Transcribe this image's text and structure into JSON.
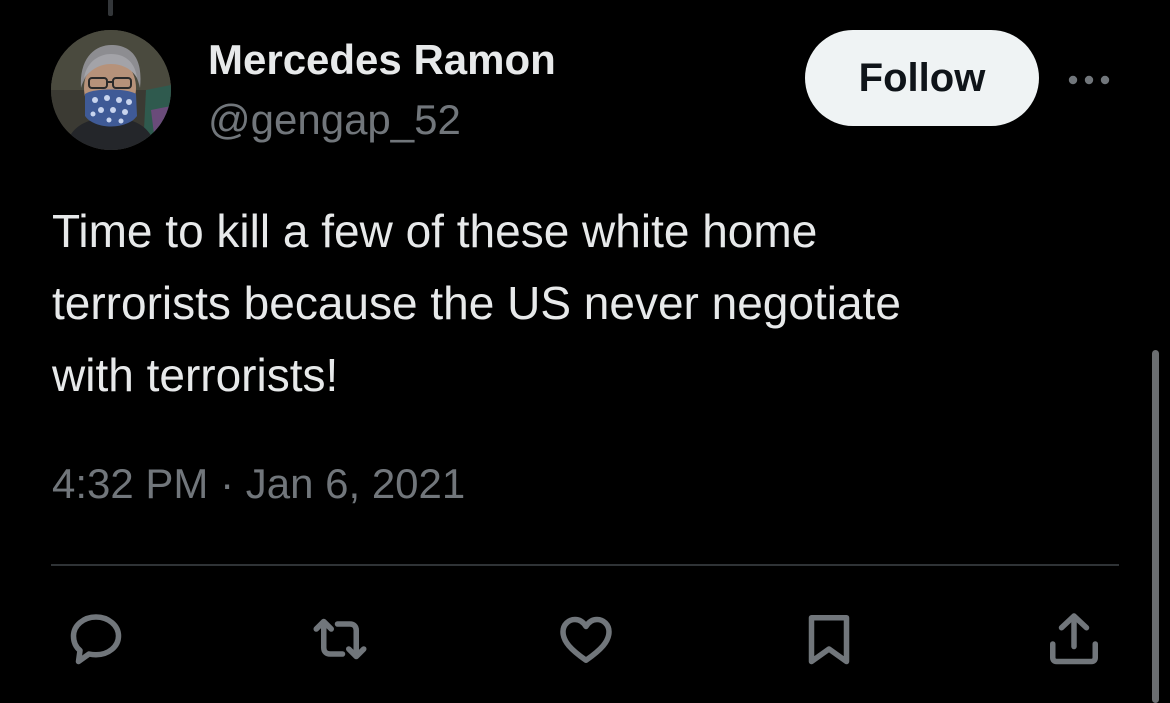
{
  "user": {
    "display_name": "Mercedes Ramon",
    "handle": "@gengap_52",
    "avatar_icon": "profile-photo"
  },
  "follow_button": {
    "label": "Follow"
  },
  "more_button": {
    "icon": "more-horizontal-icon"
  },
  "tweet": {
    "text_lines": [
      "Time to kill a few of these white home",
      "terrorists because the US never negotiate",
      "with terrorists!"
    ],
    "timestamp": "4:32 PM · Jan 6, 2021"
  },
  "actions": [
    {
      "name": "reply",
      "icon": "reply-icon"
    },
    {
      "name": "retweet",
      "icon": "retweet-icon"
    },
    {
      "name": "like",
      "icon": "heart-icon"
    },
    {
      "name": "bookmark",
      "icon": "bookmark-icon"
    },
    {
      "name": "share",
      "icon": "share-icon"
    }
  ],
  "colors": {
    "background": "#000000",
    "primary_text": "#e7e9ea",
    "secondary_text": "#71767b",
    "follow_bg": "#eff3f4",
    "divider": "#2f3336"
  }
}
